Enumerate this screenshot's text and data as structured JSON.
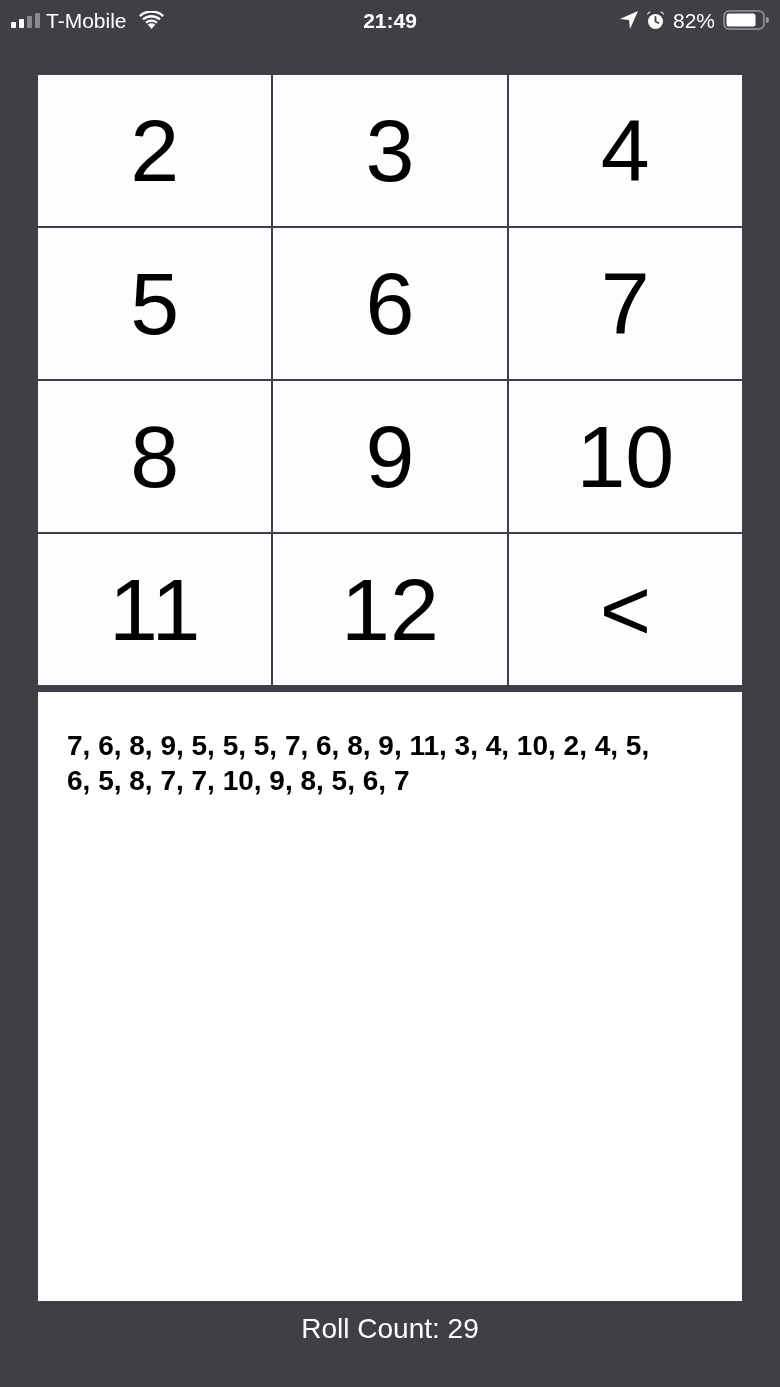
{
  "status_bar": {
    "carrier": "T-Mobile",
    "time": "21:49",
    "battery": "82%"
  },
  "keypad": {
    "keys": [
      "2",
      "3",
      "4",
      "5",
      "6",
      "7",
      "8",
      "9",
      "10",
      "11",
      "12",
      "<"
    ]
  },
  "roll_history": {
    "text": "7, 6, 8, 9, 5, 5, 5, 7, 6, 8, 9, 11, 3, 4, 10, 2, 4, 5, 6, 5, 8, 7, 7, 10, 9, 8, 5, 6, 7"
  },
  "roll_count": "Roll Count: 29"
}
